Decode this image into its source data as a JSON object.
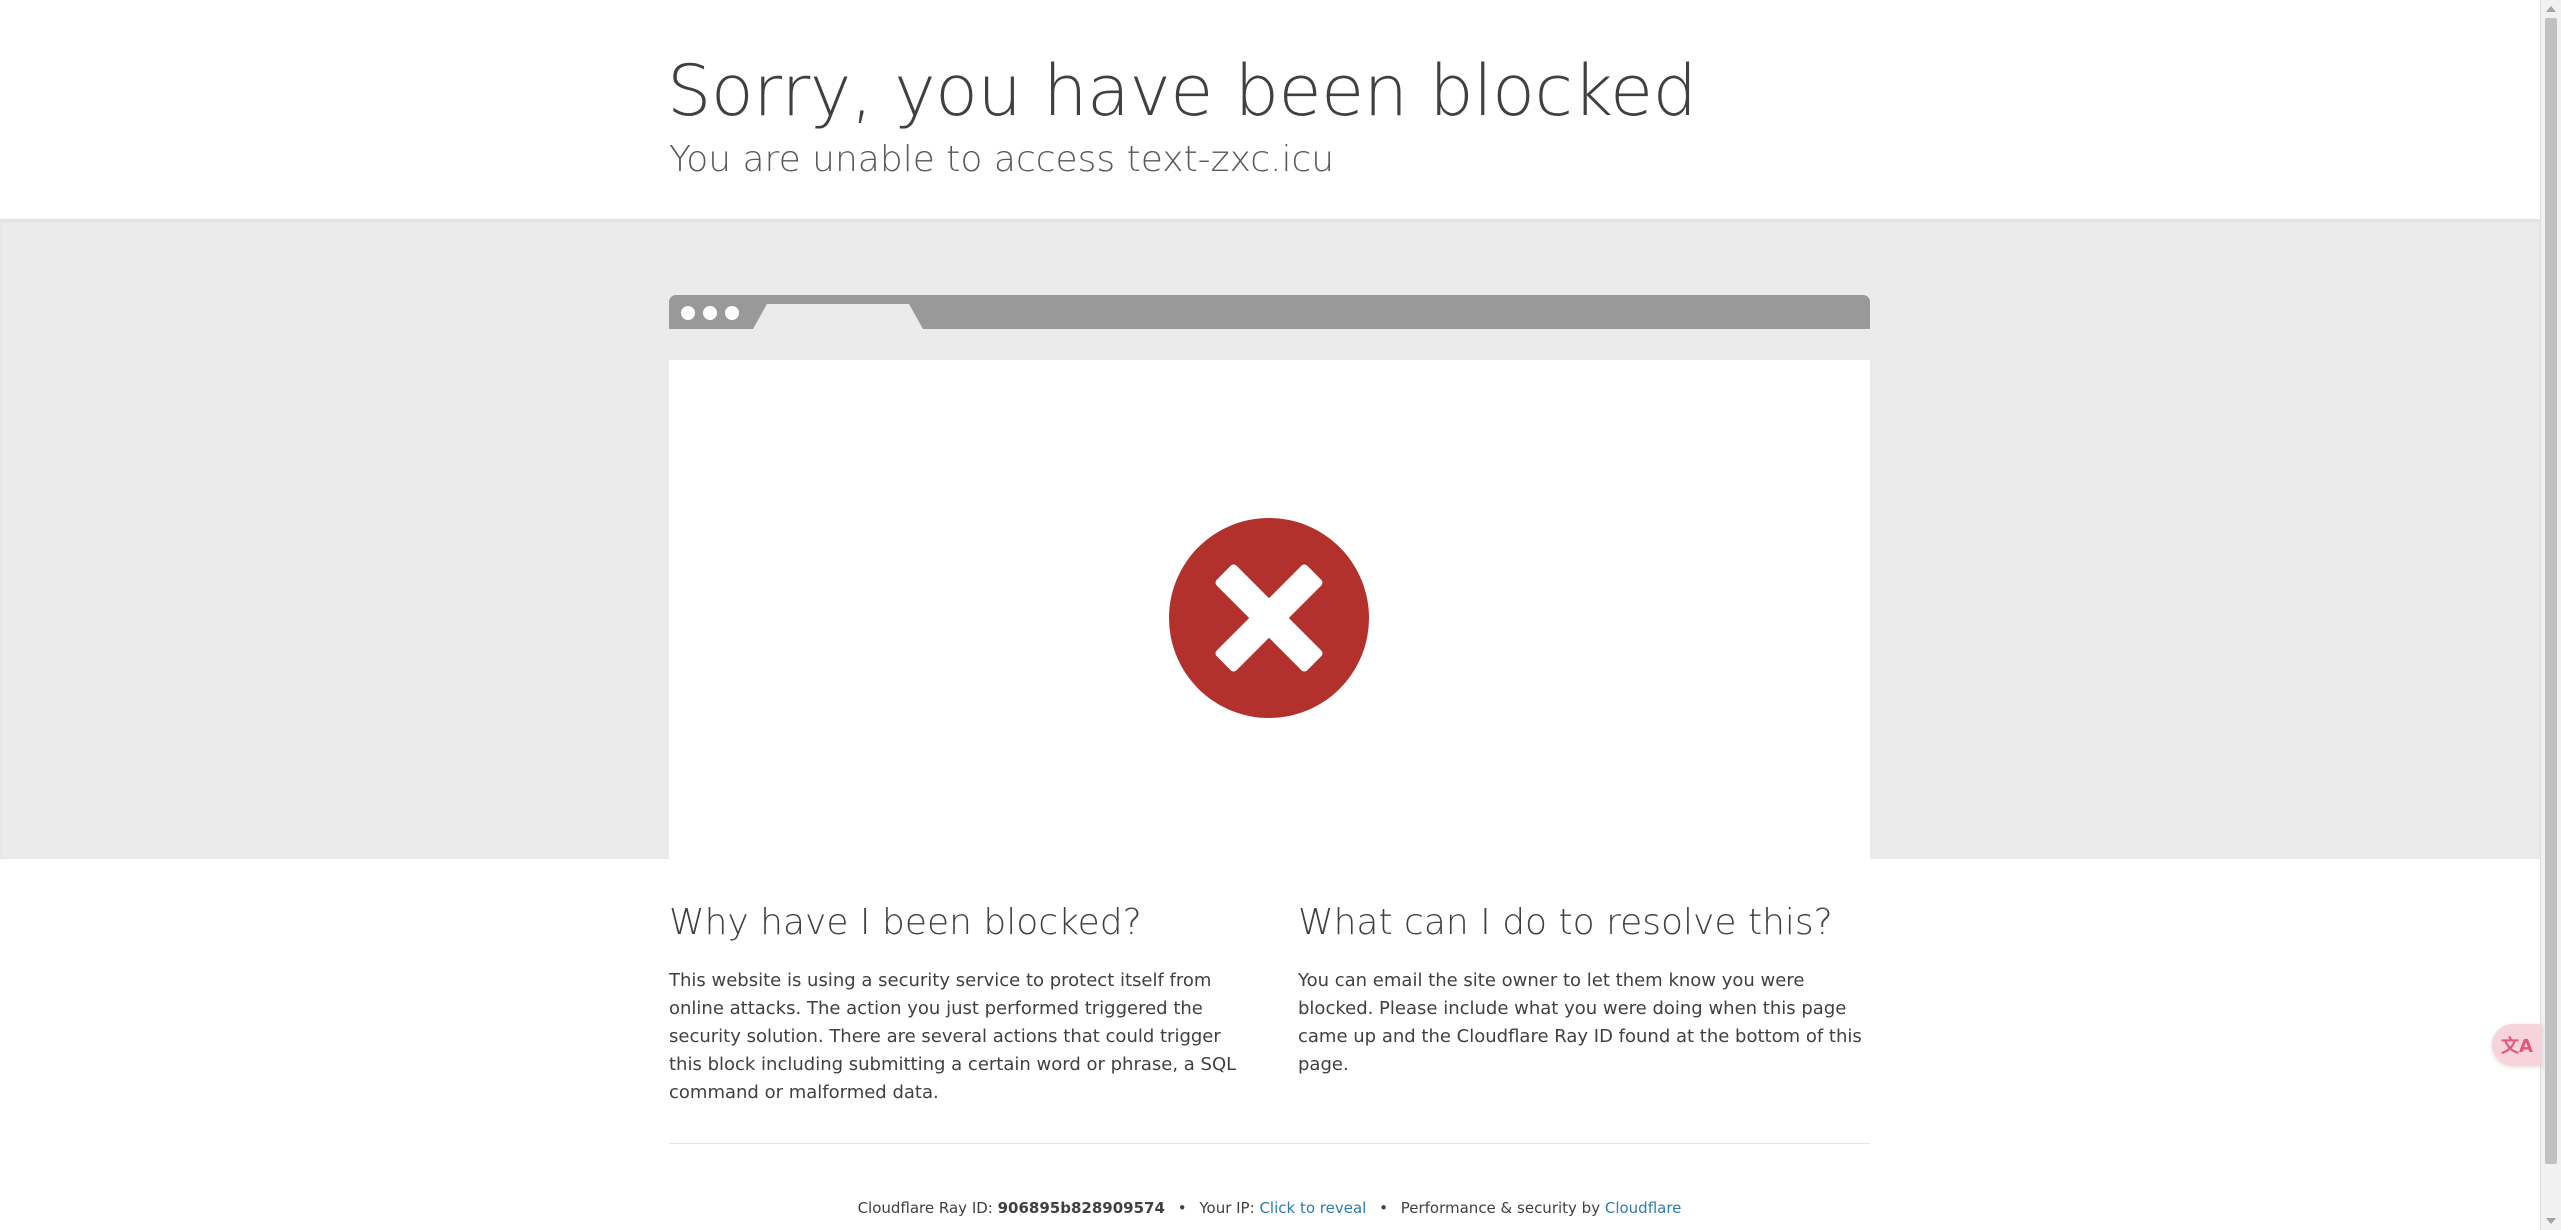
{
  "header": {
    "title": "Sorry, you have been blocked",
    "subtitle": "You are unable to access text-zxc.icu"
  },
  "icons": {
    "error": "error-x-circle-icon",
    "translate": "translate-icon",
    "translate_glyph": "文A"
  },
  "colors": {
    "error_red": "#b3312c",
    "link_blue": "#2c7cb0",
    "band_gray": "#ebebeb",
    "browser_bar": "#999999"
  },
  "why": {
    "heading": "Why have I been blocked?",
    "body": "This website is using a security service to protect itself from online attacks. The action you just performed triggered the security solution. There are several actions that could trigger this block including submitting a certain word or phrase, a SQL command or malformed data."
  },
  "resolve": {
    "heading": "What can I do to resolve this?",
    "body": "You can email the site owner to let them know you were blocked. Please include what you were doing when this page came up and the Cloudflare Ray ID found at the bottom of this page."
  },
  "footer": {
    "ray_label": "Cloudflare Ray ID:",
    "ray_id": "906895b828909574",
    "separator": "•",
    "ip_label": "Your IP:",
    "ip_link": "Click to reveal",
    "perf_label": "Performance & security by",
    "cf_link": "Cloudflare"
  }
}
